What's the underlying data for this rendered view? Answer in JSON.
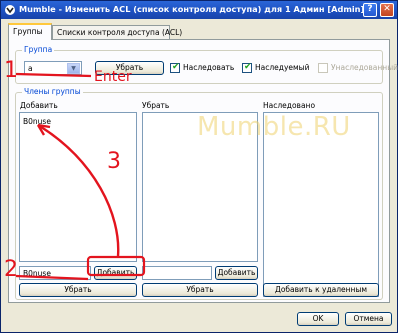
{
  "window": {
    "title": "Mumble - Изменить ACL (список контроля доступа) для 1 Админ [Admin]",
    "help_label": "?",
    "close_label": "✕"
  },
  "tabs": [
    {
      "label": "Группы",
      "active": true
    },
    {
      "label": "Списки контроля доступа (ACL)",
      "active": false
    }
  ],
  "group_section": {
    "legend": "Группа",
    "combo_value": "a",
    "remove_button": "Убрать",
    "inherit": {
      "label": "Наследовать",
      "checked": true
    },
    "inheritable": {
      "label": "Наследуемый",
      "checked": true
    },
    "inherited": {
      "label": "Унаследованный",
      "checked": false,
      "disabled": true
    }
  },
  "members_section": {
    "legend": "Члены группы",
    "add_column": {
      "label": "Добавить",
      "items": [
        "B0nuse"
      ],
      "input_value": "B0nuse",
      "add_button": "Добавить"
    },
    "remove_column": {
      "label": "Убрать",
      "items": [],
      "input_value": "",
      "add_button": "Добавить"
    },
    "inherited_column": {
      "label": "Наследовано",
      "items": []
    },
    "bottom_buttons": {
      "remove_left": "Убрать",
      "remove_middle": "Убрать",
      "add_to_removed": "Добавить к удаленным"
    }
  },
  "dialog_buttons": {
    "ok": "OK",
    "cancel": "Отмена"
  },
  "watermark": "Mumble.RU",
  "annotations": {
    "step1": "1",
    "step2": "2",
    "step3": "3",
    "enter_label": "Enter"
  },
  "colors": {
    "annotation": "#e3141e",
    "titlebar": "#1d4fbf",
    "checkmark": "#21a121"
  }
}
